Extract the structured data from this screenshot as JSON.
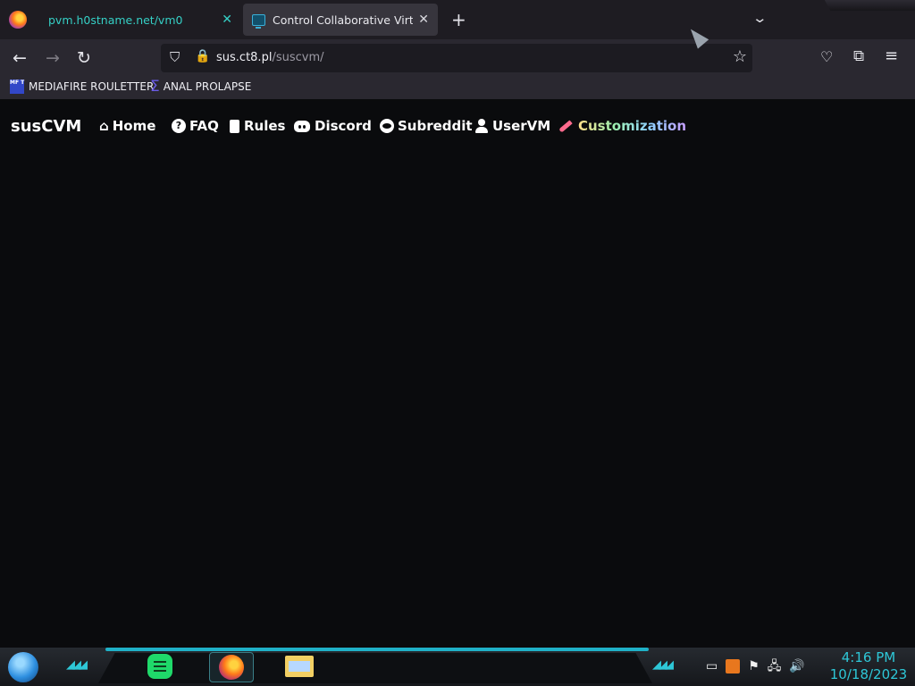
{
  "browser": {
    "tabs": [
      {
        "title": "pvm.h0stname.net/vm0",
        "active": false
      },
      {
        "title": "Control Collaborative Virtual M",
        "active": true
      }
    ],
    "new_tab_label": "+",
    "list_tabs_label": "⌄",
    "url_host": "sus.ct8.pl",
    "url_path": "/suscvm/",
    "bookmarks": [
      {
        "icon_text": "MF T",
        "label": "MEDIAFIRE ROULETTER"
      },
      {
        "icon_text": "Σ",
        "label": "ANAL PROLAPSE"
      }
    ],
    "icons": {
      "back": "←",
      "forward": "→",
      "reload": "↻",
      "shield": "⛉",
      "lock": "🔒",
      "star": "☆",
      "pocket": "♡",
      "extensions": "⧉",
      "menu": "≡"
    }
  },
  "site": {
    "brand": "susCVM",
    "nav": [
      {
        "label": "Home",
        "icon": "⌂"
      },
      {
        "label": "FAQ",
        "icon": "?"
      },
      {
        "label": "Rules",
        "icon": "clipboard"
      },
      {
        "label": "Discord",
        "icon": "discord"
      },
      {
        "label": "Subreddit",
        "icon": "reddit"
      },
      {
        "label": "UserVM",
        "icon": "user"
      },
      {
        "label": "Customization",
        "icon": "brush"
      }
    ]
  },
  "taskbar": {
    "chevrons": "◢◢◢",
    "tray": {
      "flag": "⚑",
      "network": "🖧",
      "volume": "🔊"
    },
    "time": "4:16 PM",
    "date": "10/18/2023"
  },
  "colors": {
    "accent": "#2ec7d7",
    "tab_inactive_text": "#35d0c6",
    "page_bg": "#0a0b0d"
  }
}
